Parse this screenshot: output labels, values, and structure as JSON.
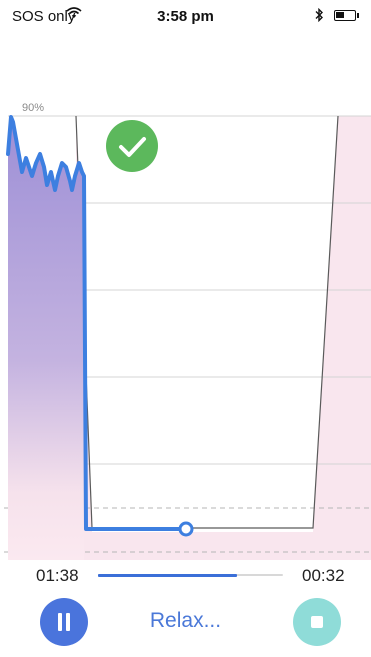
{
  "status_bar": {
    "carrier": "SOS only",
    "time": "3:58 pm",
    "wifi_icon": "wifi-icon",
    "bluetooth_icon": "bluetooth-icon",
    "battery_icon": "battery-icon"
  },
  "chart": {
    "top_label": "90%",
    "badge_icon": "checkmark-icon",
    "colors": {
      "line": "#3d7fe0",
      "exhale_fill": "#f9e6ee",
      "inhale_fill_top": "#9d8fd6",
      "badge": "#5cb85c"
    }
  },
  "chart_data": {
    "type": "line",
    "series": [
      {
        "values": [
          0.88,
          0.96,
          0.95,
          0.84,
          0.87,
          0.83,
          0.86,
          0.88,
          0.85,
          0.81,
          0.84,
          0.8,
          0.83,
          0.86,
          0.85,
          0.82,
          0.8,
          0.83,
          0.86,
          0.84,
          0.83,
          0.05,
          0.05,
          0.05,
          0.05
        ]
      }
    ],
    "grid": true
  },
  "playback": {
    "elapsed": "01:38",
    "remaining": "00:32",
    "progress": 0.75
  },
  "controls": {
    "pause_icon": "pause-icon",
    "status_text": "Relax...",
    "stop_icon": "stop-icon"
  }
}
